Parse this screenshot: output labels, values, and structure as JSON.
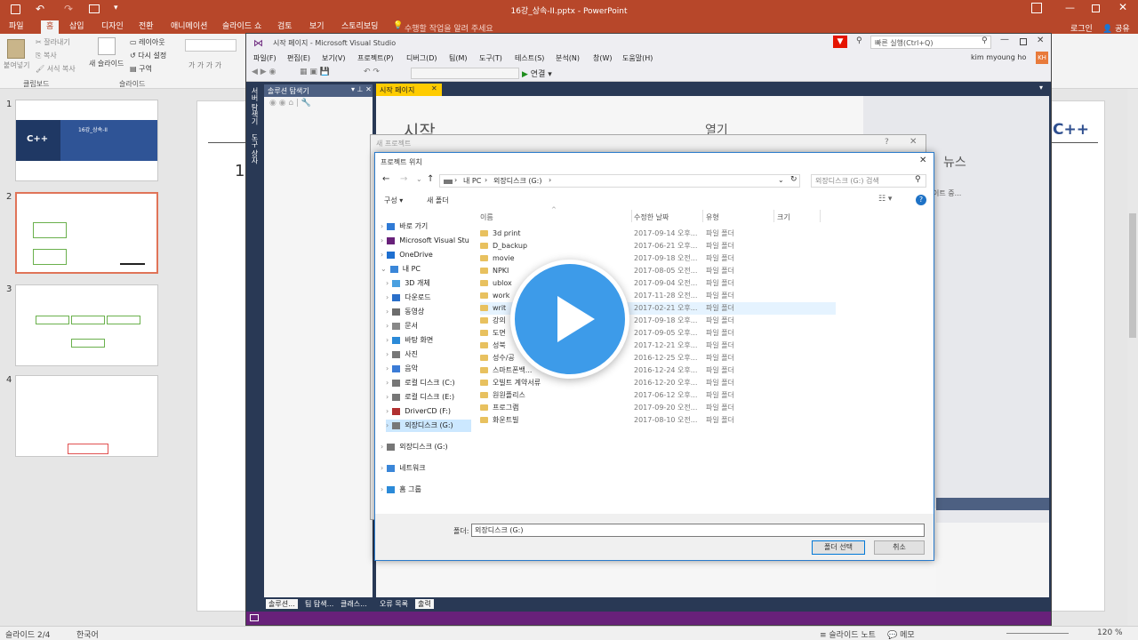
{
  "ppt": {
    "title": "16강_상속-II.pptx - PowerPoint",
    "tabs": [
      "파일",
      "홈",
      "삽입",
      "디자인",
      "전환",
      "애니메이션",
      "슬라이드 쇼",
      "검토",
      "보기",
      "스토리보딩"
    ],
    "tell_me": "수행할 작업을 알려 주세요",
    "user": "로그인",
    "share": "공유",
    "ribbon": {
      "cut": "잘라내기",
      "copy": "복사",
      "format_painter": "서식 복사",
      "paste": "붙여넣기",
      "new_slide": "새 슬라이드",
      "layout": "레이아웃",
      "reset": "다시 설정",
      "section": "구역",
      "clipboard": "클립보드",
      "slides": "슬라이드"
    },
    "slides": [
      {
        "num": "1",
        "title": "16강_상속-II",
        "badge": "C++"
      },
      {
        "num": "2"
      },
      {
        "num": "3"
      },
      {
        "num": "4"
      }
    ],
    "slide_main": {
      "title_frag": "1",
      "cpp": "C++"
    },
    "status": {
      "slide": "슬라이드 2/4",
      "lang": "한국어",
      "notes": "슬라이드 노트",
      "memo": "메모",
      "zoom": "120 %"
    }
  },
  "vs": {
    "title": "시작 페이지 - Microsoft Visual Studio",
    "quick_launch": "빠른 실행(Ctrl+Q)",
    "user": "kim myoung ho",
    "user_initials": "KH",
    "menu": [
      "파일(F)",
      "편집(E)",
      "보기(V)",
      "프로젝트(P)",
      "디버그(D)",
      "팀(M)",
      "도구(T)",
      "테스트(S)",
      "분석(N)",
      "창(W)",
      "도움말(H)"
    ],
    "attach": "연결",
    "side_tabs": [
      "서버 탐색기",
      "도구 상자"
    ],
    "solution_explorer": "솔루션 탐색기",
    "start_tab": "시작 페이지",
    "start_heading": "시작",
    "open_heading": "열기",
    "news": "뉴스",
    "news_sub": "이트 중...",
    "bottom_tabs": [
      "솔루션...",
      "팀 탐색...",
      "클래스..."
    ],
    "output_tabs": [
      "오류 목록",
      "출력"
    ]
  },
  "new_project": {
    "title": "새 프로젝트",
    "help": "?"
  },
  "dialog": {
    "title": "프로젝트 위치",
    "breadcrumb": [
      "내 PC",
      "외장디스크 (G:)"
    ],
    "search_placeholder": "외장디스크 (G:) 검색",
    "organize": "구성",
    "new_folder": "새 폴더",
    "columns": [
      "이름",
      "수정한 날짜",
      "유형",
      "크기"
    ],
    "nav": [
      {
        "label": "바로 가기",
        "icon": "star-icon"
      },
      {
        "label": "Microsoft Visual Stu",
        "icon": "vs-icon"
      },
      {
        "label": "OneDrive",
        "icon": "cloud-icon"
      },
      {
        "label": "내 PC",
        "icon": "pc-icon"
      },
      {
        "label": "3D 개체",
        "icon": "cube-icon"
      },
      {
        "label": "다운로드",
        "icon": "download-icon"
      },
      {
        "label": "동영상",
        "icon": "video-icon"
      },
      {
        "label": "문서",
        "icon": "doc-icon"
      },
      {
        "label": "바탕 화면",
        "icon": "desktop-icon"
      },
      {
        "label": "사진",
        "icon": "picture-icon"
      },
      {
        "label": "음악",
        "icon": "music-icon"
      },
      {
        "label": "로컬 디스크 (C:)",
        "icon": "drive-icon"
      },
      {
        "label": "로컬 디스크 (E:)",
        "icon": "drive-icon"
      },
      {
        "label": "DriverCD (F:)",
        "icon": "cd-icon"
      },
      {
        "label": "외장디스크 (G:)",
        "icon": "drive-icon"
      },
      {
        "label": "외장디스크 (G:)",
        "icon": "drive-icon"
      },
      {
        "label": "네트워크",
        "icon": "network-icon"
      },
      {
        "label": "홈 그룹",
        "icon": "homegroup-icon"
      }
    ],
    "files": [
      {
        "name": "3d print",
        "date": "2017-09-14 오후...",
        "type": "파일 폴더"
      },
      {
        "name": "D_backup",
        "date": "2017-06-21 오후...",
        "type": "파일 폴더"
      },
      {
        "name": "movie",
        "date": "2017-09-18 오전...",
        "type": "파일 폴더"
      },
      {
        "name": "NPKI",
        "date": "2017-08-05 오전...",
        "type": "파일 폴더"
      },
      {
        "name": "ublox",
        "date": "2017-09-04 오전...",
        "type": "파일 폴더"
      },
      {
        "name": "work",
        "date": "2017-11-28 오전...",
        "type": "파일 폴더"
      },
      {
        "name": "writ",
        "date": "2017-02-21 오후...",
        "type": "파일 폴더"
      },
      {
        "name": "강의",
        "date": "2017-09-18 오후...",
        "type": "파일 폴더"
      },
      {
        "name": "도면",
        "date": "2017-09-05 오후...",
        "type": "파일 폴더"
      },
      {
        "name": "성북",
        "date": "2017-12-21 오후...",
        "type": "파일 폴더"
      },
      {
        "name": "성수/공",
        "date": "2016-12-25 오후...",
        "type": "파일 폴더"
      },
      {
        "name": "스마트폰백...",
        "date": "2016-12-24 오후...",
        "type": "파일 폴더"
      },
      {
        "name": "오빌트 계약서류",
        "date": "2016-12-20 오후...",
        "type": "파일 폴더"
      },
      {
        "name": "원원플리스",
        "date": "2017-06-12 오후...",
        "type": "파일 폴더"
      },
      {
        "name": "프로그램",
        "date": "2017-09-20 오전...",
        "type": "파일 폴더"
      },
      {
        "name": "화운트빌",
        "date": "2017-08-10 오전...",
        "type": "파일 폴더"
      }
    ],
    "folder_label": "폴더:",
    "folder_value": "외장디스크 (G:)",
    "select_btn": "폴더 선택",
    "cancel_btn": "취소"
  }
}
